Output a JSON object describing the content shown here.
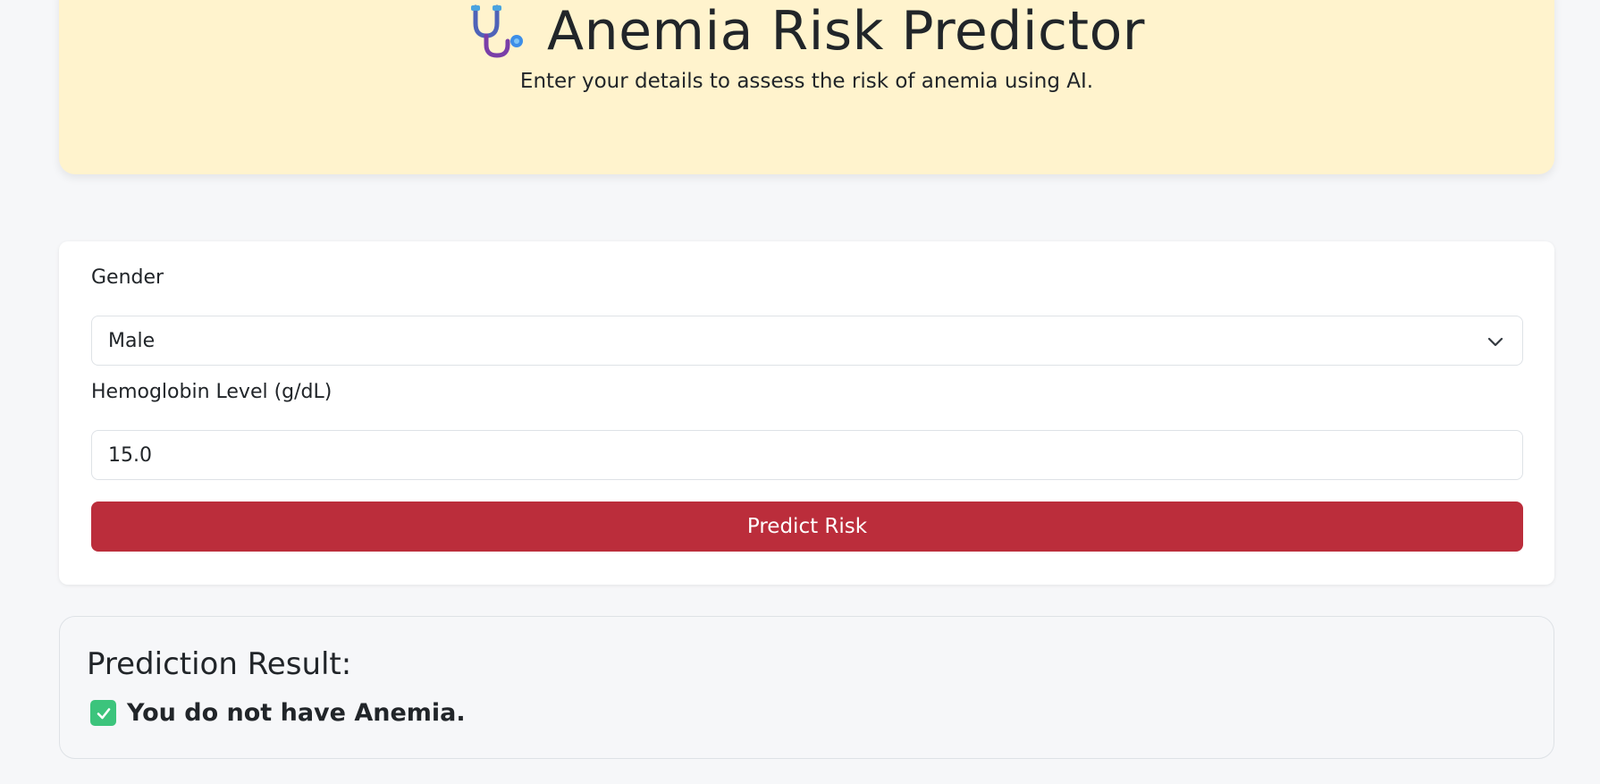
{
  "header": {
    "icon": "stethoscope-icon",
    "title": "Anemia Risk Predictor",
    "subtitle": "Enter your details to assess the risk of anemia using AI."
  },
  "form": {
    "gender_label": "Gender",
    "gender_value": "Male",
    "hemoglobin_label": "Hemoglobin Level (g/dL)",
    "hemoglobin_value": "15.0",
    "submit_label": "Predict Risk"
  },
  "result": {
    "heading": "Prediction Result:",
    "icon": "check-mark-icon",
    "message": "You do not have Anemia."
  },
  "colors": {
    "header_bg": "#fff3cd",
    "button_bg": "#bb2d3b",
    "check_bg": "#3cc47c",
    "page_bg": "#f6f7f9"
  }
}
